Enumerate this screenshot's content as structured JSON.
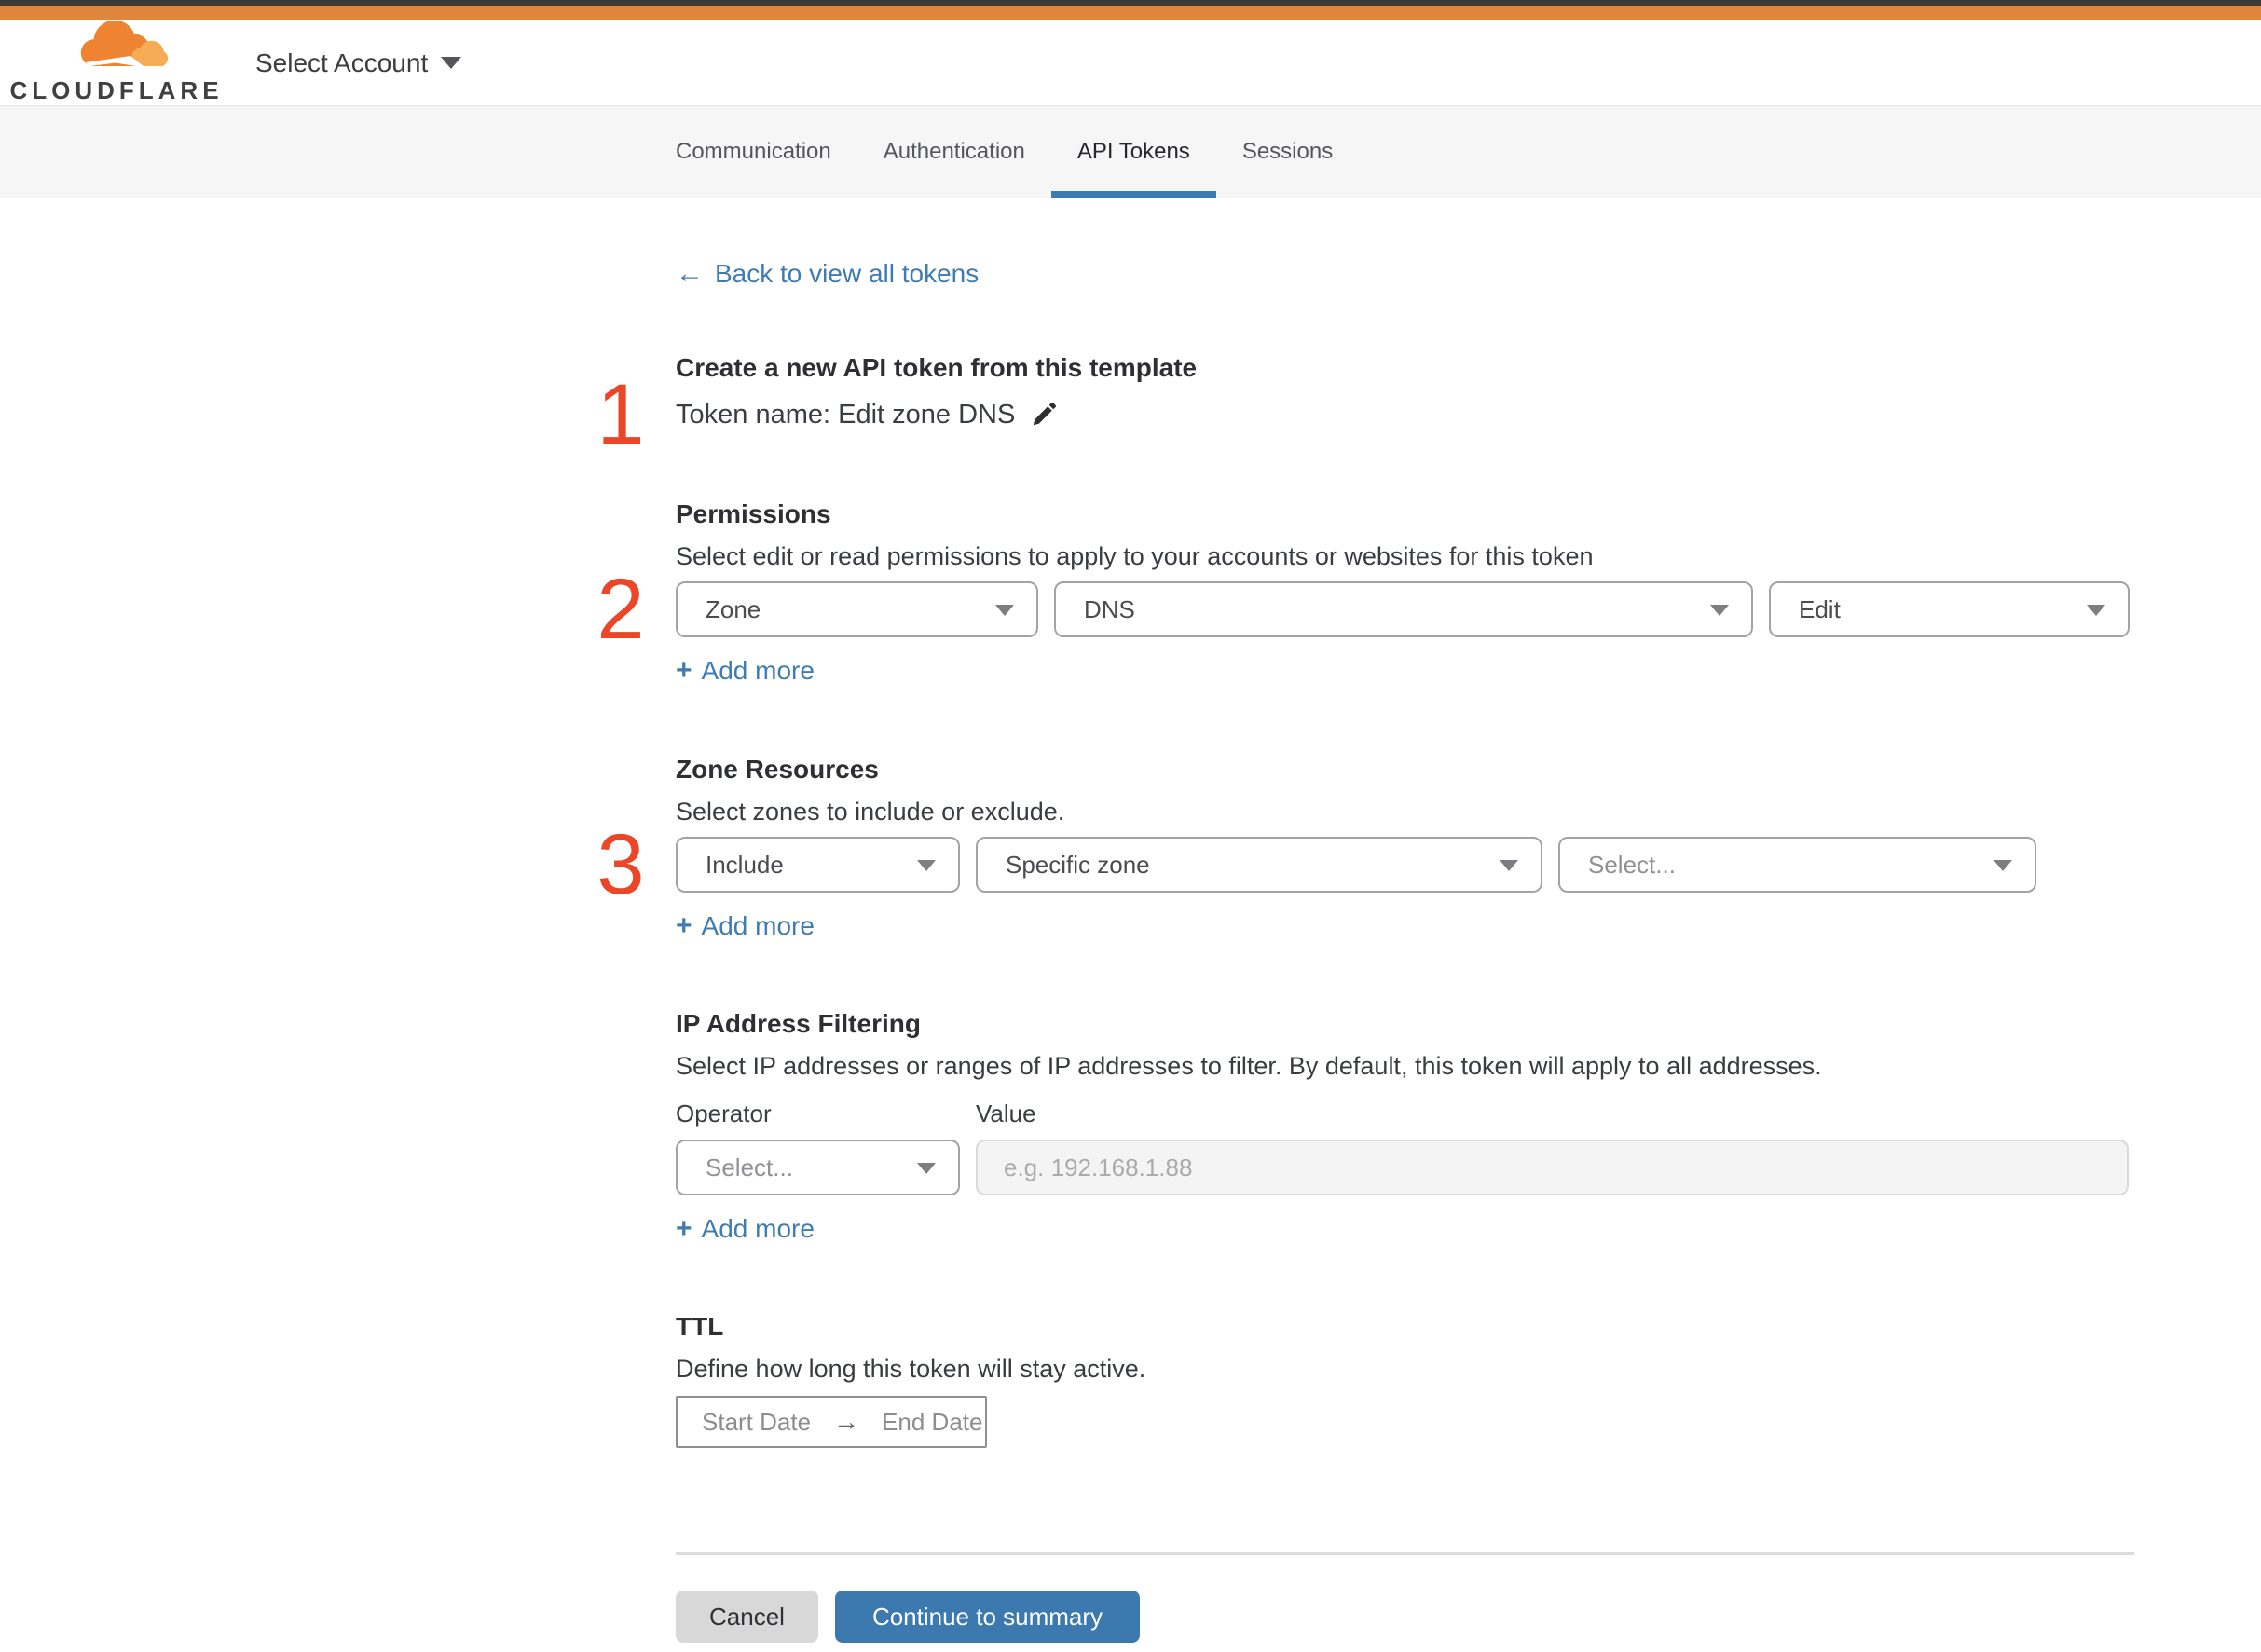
{
  "header": {
    "brand": "CLOUDFLARE",
    "account_selector": "Select Account"
  },
  "tabs": {
    "items": [
      {
        "label": "Communication"
      },
      {
        "label": "Authentication"
      },
      {
        "label": "API Tokens"
      },
      {
        "label": "Sessions"
      }
    ]
  },
  "back_link": {
    "arrow": "←",
    "label": "Back to view all tokens"
  },
  "steps": {
    "one": "1",
    "two": "2",
    "three": "3"
  },
  "labels": {
    "plus": "+",
    "add_more": "Add more"
  },
  "token_section": {
    "heading": "Create a new API token from this template",
    "token_name": "Token name: Edit zone DNS"
  },
  "permissions": {
    "heading": "Permissions",
    "description": "Select edit or read permissions to apply to your accounts or websites for this token",
    "resource_select": "Zone",
    "scope_select": "DNS",
    "access_select": "Edit"
  },
  "zone_resources": {
    "heading": "Zone Resources",
    "description": "Select zones to include or exclude.",
    "operator_select": "Include",
    "type_select": "Specific zone",
    "zone_select_placeholder": "Select..."
  },
  "ip_filtering": {
    "heading": "IP Address Filtering",
    "description": "Select IP addresses or ranges of IP addresses to filter. By default, this token will apply to all addresses.",
    "operator_label": "Operator",
    "value_label": "Value",
    "operator_placeholder": "Select...",
    "value_placeholder": "e.g. 192.168.1.88"
  },
  "ttl": {
    "heading": "TTL",
    "description": "Define how long this token will stay active.",
    "start_placeholder": "Start Date",
    "arrow": "→",
    "end_placeholder": "End Date"
  },
  "footer": {
    "cancel": "Cancel",
    "continue": "Continue to summary"
  },
  "colors": {
    "accent_blue": "#3e7cb1",
    "brand_orange": "#e0863a",
    "step_red": "#ea4627",
    "tab_underline": "#3c7bb1"
  }
}
